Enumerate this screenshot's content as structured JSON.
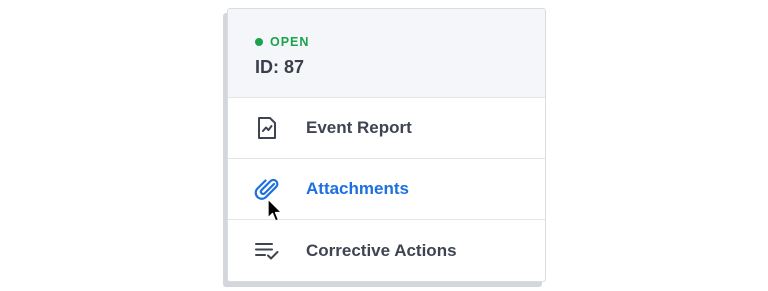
{
  "header": {
    "status": "OPEN",
    "id_label": "ID: 87"
  },
  "menu": {
    "items": [
      {
        "label": "Event Report",
        "icon": "chart-document-icon",
        "active": false
      },
      {
        "label": "Attachments",
        "icon": "paperclip-icon",
        "active": true
      },
      {
        "label": "Corrective Actions",
        "icon": "checklist-icon",
        "active": false
      }
    ]
  },
  "colors": {
    "status_open": "#1aa34a",
    "active_link": "#1e6fe0",
    "text": "#3f4452",
    "header_bg": "#f5f6fa"
  }
}
